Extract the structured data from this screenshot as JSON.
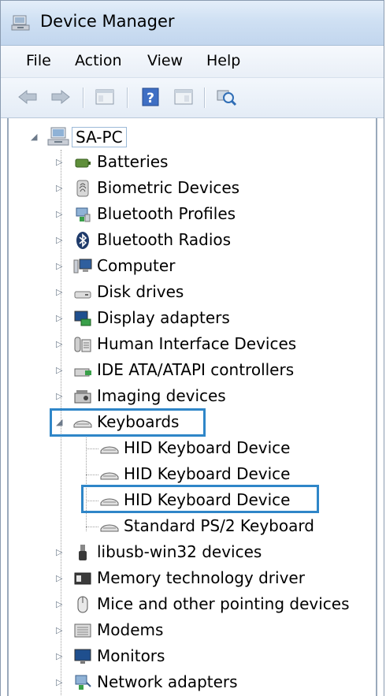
{
  "window": {
    "title": "Device Manager",
    "title_icon": "device-manager-icon"
  },
  "menu": [
    "File",
    "Action",
    "View",
    "Help"
  ],
  "toolbar": {
    "buttons": [
      "back-arrow-icon",
      "forward-arrow-icon",
      "properties-icon",
      "help-icon",
      "show-hidden-icon",
      "scan-hardware-icon"
    ]
  },
  "tree": {
    "root": {
      "label": "SA-PC",
      "icon": "computer-network-icon",
      "expanded": true
    },
    "categories": [
      {
        "label": "Batteries",
        "icon": "battery-icon",
        "expanded": false
      },
      {
        "label": "Biometric Devices",
        "icon": "fingerprint-icon",
        "expanded": false
      },
      {
        "label": "Bluetooth Profiles",
        "icon": "bluetooth-profile-icon",
        "expanded": false
      },
      {
        "label": "Bluetooth Radios",
        "icon": "bluetooth-icon",
        "expanded": false
      },
      {
        "label": "Computer",
        "icon": "computer-icon",
        "expanded": false
      },
      {
        "label": "Disk drives",
        "icon": "disk-drive-icon",
        "expanded": false
      },
      {
        "label": "Display adapters",
        "icon": "display-adapter-icon",
        "expanded": false
      },
      {
        "label": "Human Interface Devices",
        "icon": "hid-icon",
        "expanded": false
      },
      {
        "label": "IDE ATA/ATAPI controllers",
        "icon": "ide-controller-icon",
        "expanded": false
      },
      {
        "label": "Imaging devices",
        "icon": "camera-icon",
        "expanded": false
      },
      {
        "label": "Keyboards",
        "icon": "keyboard-icon",
        "expanded": true,
        "highlighted": true,
        "children": [
          {
            "label": "HID Keyboard Device",
            "icon": "keyboard-icon"
          },
          {
            "label": "HID Keyboard Device",
            "icon": "keyboard-icon"
          },
          {
            "label": "HID Keyboard Device",
            "icon": "keyboard-icon",
            "highlighted": true
          },
          {
            "label": "Standard PS/2 Keyboard",
            "icon": "keyboard-icon"
          }
        ]
      },
      {
        "label": "libusb-win32 devices",
        "icon": "usb-icon",
        "expanded": false
      },
      {
        "label": "Memory technology driver",
        "icon": "memory-icon",
        "expanded": false
      },
      {
        "label": "Mice and other pointing devices",
        "icon": "mouse-icon",
        "expanded": false
      },
      {
        "label": "Modems",
        "icon": "modem-icon",
        "expanded": false
      },
      {
        "label": "Monitors",
        "icon": "monitor-icon",
        "expanded": false
      },
      {
        "label": "Network adapters",
        "icon": "network-adapter-icon",
        "expanded": false
      }
    ]
  },
  "colors": {
    "highlight_border": "#2f86c8",
    "titlebar": "#cfe0f3"
  }
}
